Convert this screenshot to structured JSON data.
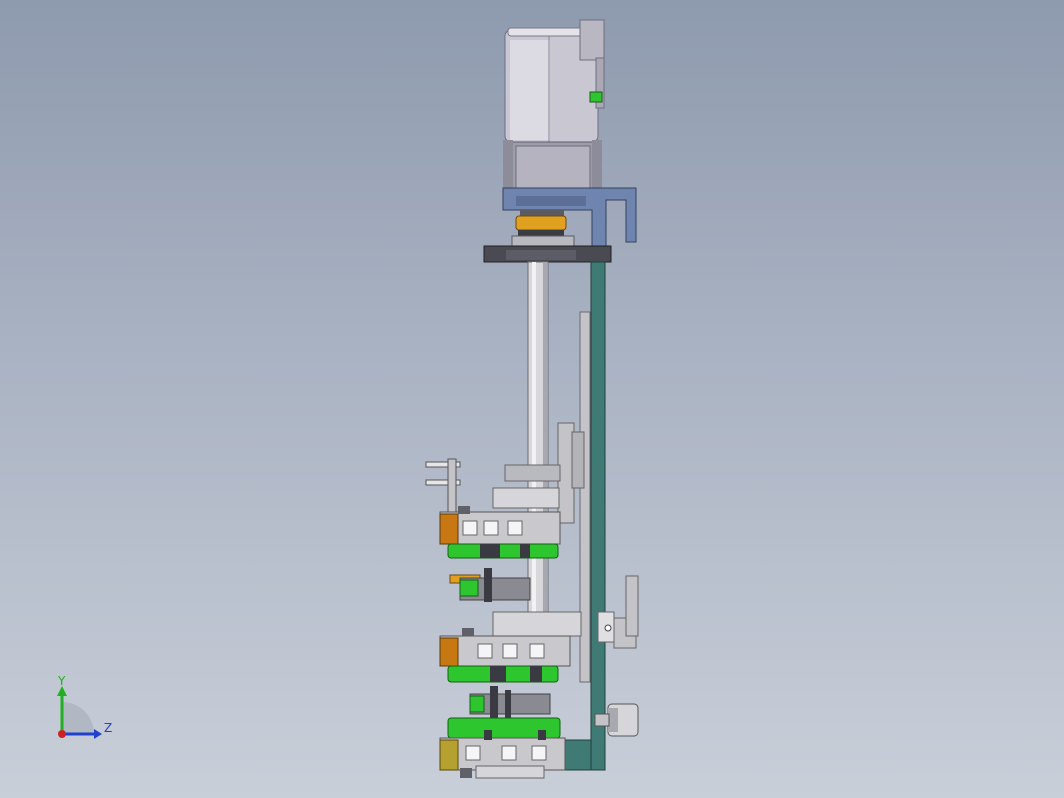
{
  "colors": {
    "background_top": "#8e9aae",
    "background_bottom": "#c9cfd9",
    "motor_body": "#c9c8d2",
    "motor_dark": "#8d8c99",
    "bracket_blue": "#6f85b0",
    "frame_teal": "#3f7b74",
    "plate_dark": "#4a4a52",
    "rail_light": "#d8d8dc",
    "block_grey": "#c4c4c8",
    "wheel_green": "#2ec62e",
    "accent_orange": "#c87812",
    "accent_gold": "#e2a020",
    "axis_x": "#d02020",
    "axis_y": "#20b020",
    "axis_z": "#2040d0"
  },
  "triad": {
    "y_label": "Y",
    "z_label": "Z"
  },
  "icons": {
    "origin": "coordinate-triad-icon"
  }
}
